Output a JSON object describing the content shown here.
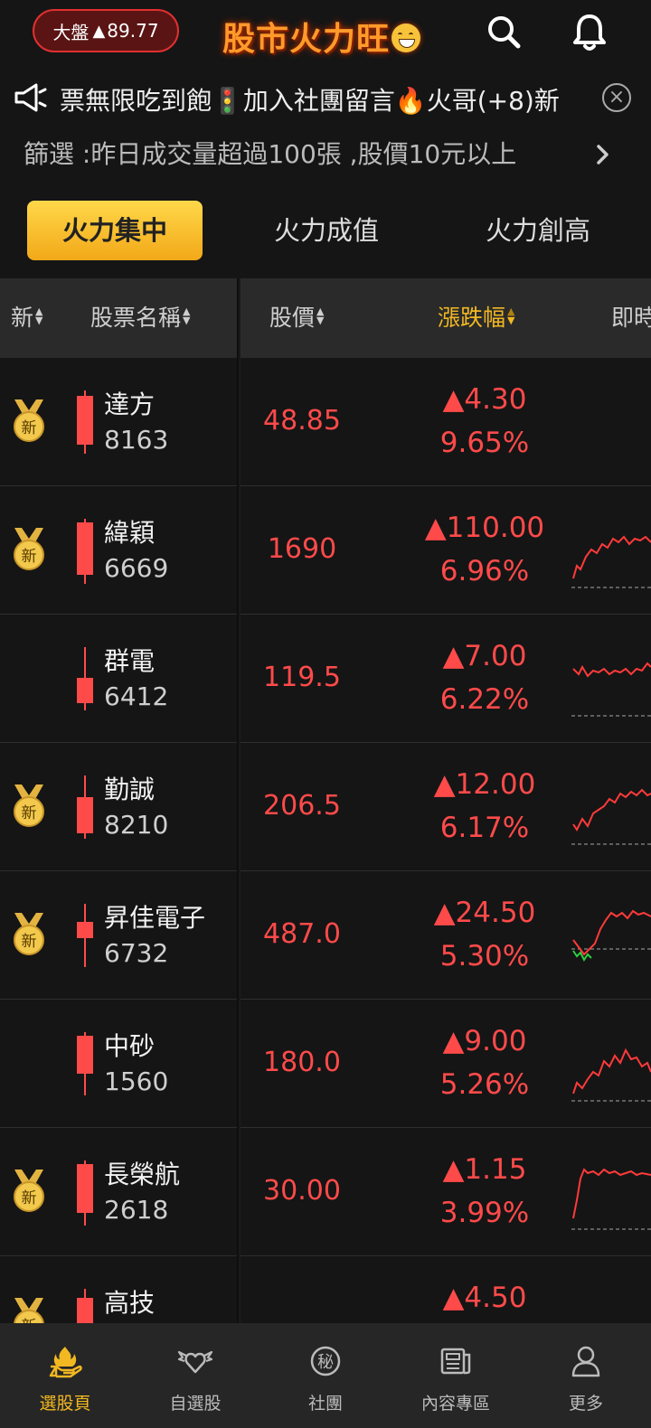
{
  "header": {
    "index_label": "大盤",
    "index_value": "89.77",
    "logo_text": "股市火力旺"
  },
  "marquee": {
    "text": "票無限吃到飽🚦加入社團留言🔥火哥(+8)新"
  },
  "filter": {
    "text": "篩選 :昨日成交量超過100張 ,股價10元以上"
  },
  "tabs": [
    {
      "label": "火力集中",
      "active": true
    },
    {
      "label": "火力成值",
      "active": false
    },
    {
      "label": "火力創高",
      "active": false
    }
  ],
  "table_header": {
    "col_new": "新",
    "col_name": "股票名稱",
    "col_price": "股價",
    "col_change": "漲跌幅",
    "col_realtime": "即時"
  },
  "medal_text": "新",
  "rows": [
    {
      "name": "達方",
      "code": "8163",
      "price": "48.85",
      "change": "▲4.30",
      "pct": "9.65%",
      "new": true
    },
    {
      "name": "緯穎",
      "code": "6669",
      "price": "1690",
      "change": "▲110.00",
      "pct": "6.96%",
      "new": true
    },
    {
      "name": "群電",
      "code": "6412",
      "price": "119.5",
      "change": "▲7.00",
      "pct": "6.22%",
      "new": false
    },
    {
      "name": "勤誠",
      "code": "8210",
      "price": "206.5",
      "change": "▲12.00",
      "pct": "6.17%",
      "new": true
    },
    {
      "name": "昇佳電子",
      "code": "6732",
      "price": "487.0",
      "change": "▲24.50",
      "pct": "5.30%",
      "new": true
    },
    {
      "name": "中砂",
      "code": "1560",
      "price": "180.0",
      "change": "▲9.00",
      "pct": "5.26%",
      "new": false
    },
    {
      "name": "長榮航",
      "code": "2618",
      "price": "30.00",
      "change": "▲1.15",
      "pct": "3.99%",
      "new": true
    },
    {
      "name": "高技",
      "code": "",
      "price": "",
      "change": "▲4.50",
      "pct": "",
      "new": true
    }
  ],
  "nav": [
    {
      "label": "選股頁",
      "icon": "fire-hand-icon",
      "active": true
    },
    {
      "label": "自選股",
      "icon": "winged-heart-icon",
      "active": false
    },
    {
      "label": "社團",
      "icon": "secret-badge-icon",
      "active": false
    },
    {
      "label": "內容專區",
      "icon": "newspaper-icon",
      "active": false
    },
    {
      "label": "更多",
      "icon": "person-icon",
      "active": false
    }
  ],
  "colors": {
    "up_red": "#ff4a4a",
    "accent_gold": "#f2b822",
    "background": "#151515"
  }
}
